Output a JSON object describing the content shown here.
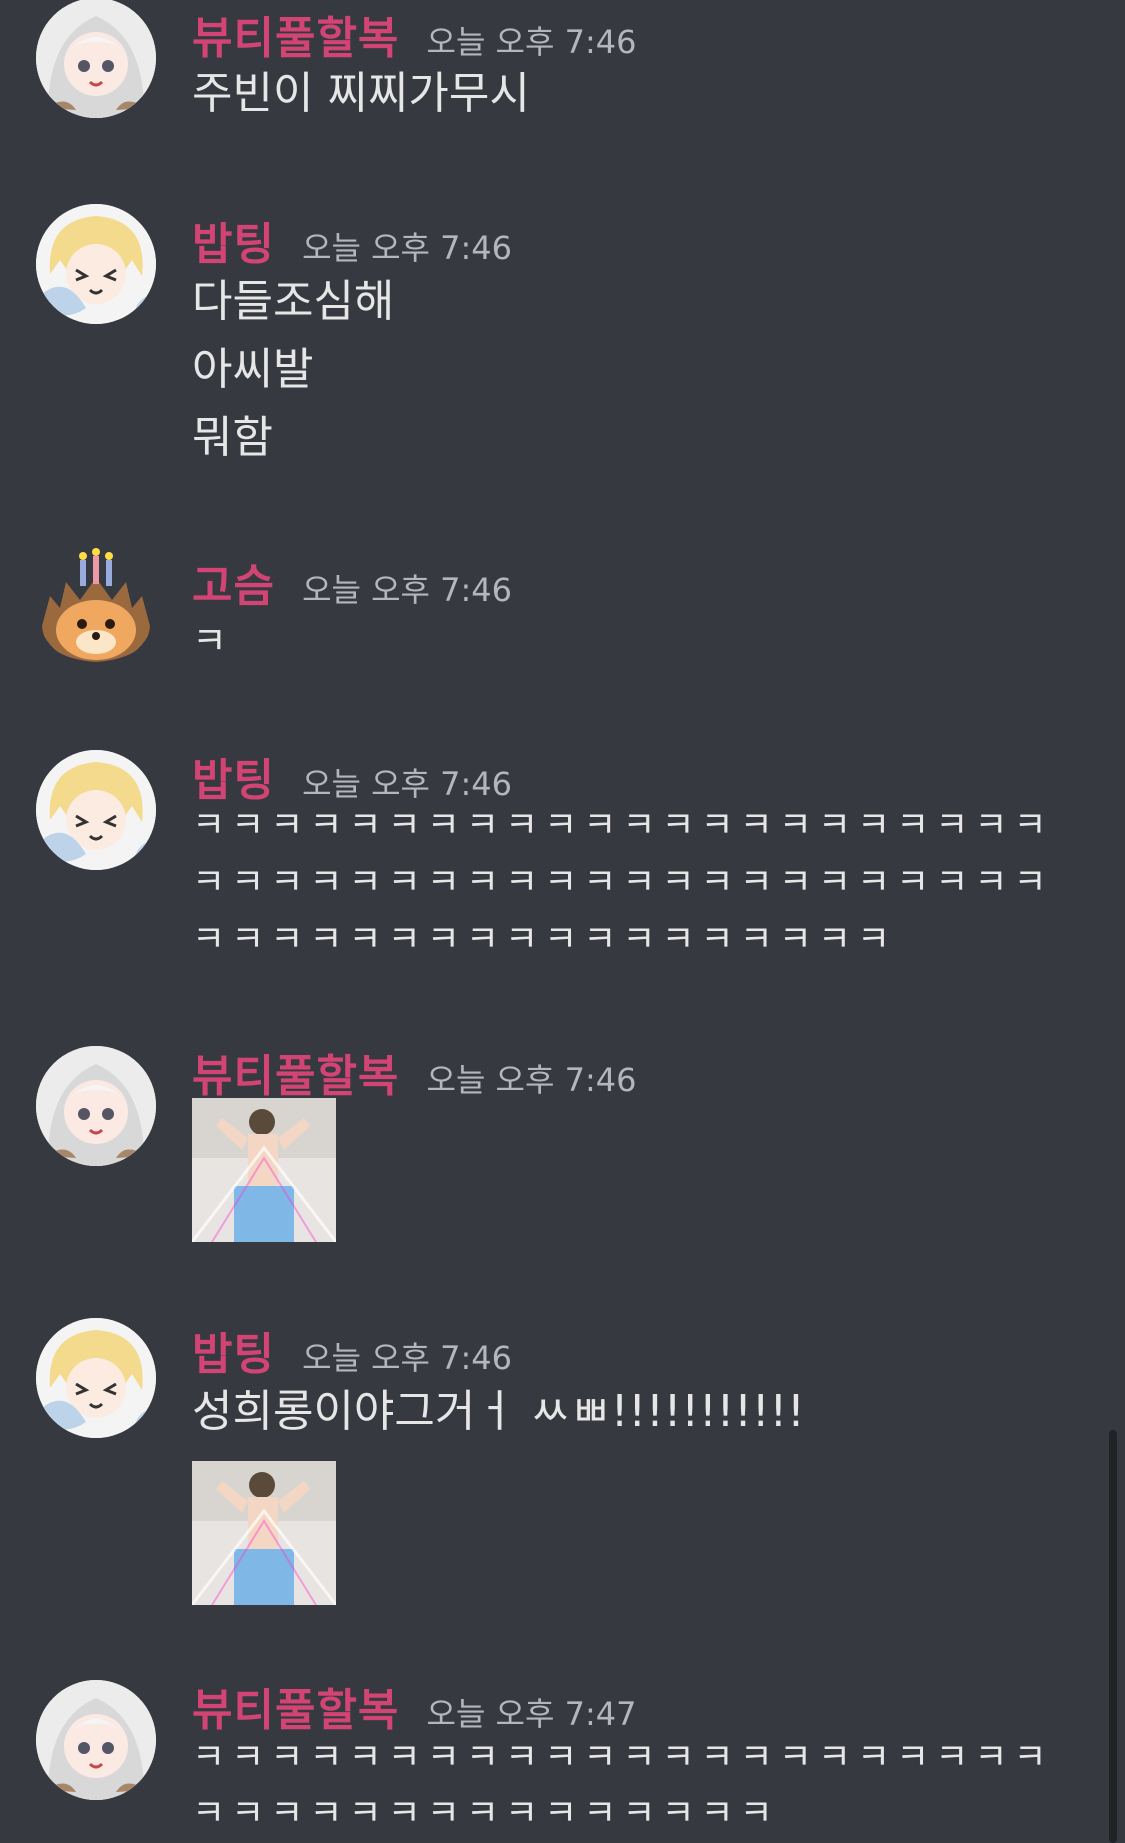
{
  "messages": [
    {
      "username": "뷰티풀할복",
      "timestamp": "오늘 오후 7:46",
      "avatar": "hooded-girl-avatar-icon",
      "lines": [
        "주빈이 찌찌가무시"
      ]
    },
    {
      "username": "밥팅",
      "timestamp": "오늘 오후 7:46",
      "avatar": "blonde-boy-avatar-icon",
      "lines": [
        "다들조심해",
        "아씨발",
        "뭐함"
      ]
    },
    {
      "username": "고슴",
      "timestamp": "오늘 오후 7:46",
      "avatar": "hedgehog-cake-avatar-icon",
      "lines": [
        "ㅋ"
      ]
    },
    {
      "username": "밥팅",
      "timestamp": "오늘 오후 7:46",
      "avatar": "blonde-boy-avatar-icon",
      "lines": [
        "ㅋㅋㅋㅋㅋㅋㅋㅋㅋㅋㅋㅋㅋㅋㅋㅋㅋㅋㅋㅋㅋㅋ",
        "ㅋㅋㅋㅋㅋㅋㅋㅋㅋㅋㅋㅋㅋㅋㅋㅋㅋㅋㅋㅋㅋㅋ",
        "ㅋㅋㅋㅋㅋㅋㅋㅋㅋㅋㅋㅋㅋㅋㅋㅋㅋㅋ"
      ]
    },
    {
      "username": "뷰티풀할복",
      "timestamp": "오늘 오후 7:46",
      "avatar": "hooded-girl-avatar-icon",
      "lines": [],
      "attachment": "image-attachment"
    },
    {
      "username": "밥팅",
      "timestamp": "오늘 오후 7:46",
      "avatar": "blonde-boy-avatar-icon",
      "lines": [
        "성희롱이야그거ㅓ ㅆㅃ!!!!!!!!!!!"
      ],
      "attachment": "image-attachment"
    },
    {
      "username": "뷰티풀할복",
      "timestamp": "오늘 오후 7:47",
      "avatar": "hooded-girl-avatar-icon",
      "lines": [
        "ㅋㅋㅋㅋㅋㅋㅋㅋㅋㅋㅋㅋㅋㅋㅋㅋㅋㅋㅋㅋㅋㅋ",
        "ㅋㅋㅋㅋㅋㅋㅋㅋㅋㅋㅋㅋㅋㅋㅋ"
      ]
    }
  ],
  "colors": {
    "background": "#36393f",
    "username": "#d24473",
    "timestamp": "#b4b6ba",
    "text": "#e6e6e6"
  }
}
